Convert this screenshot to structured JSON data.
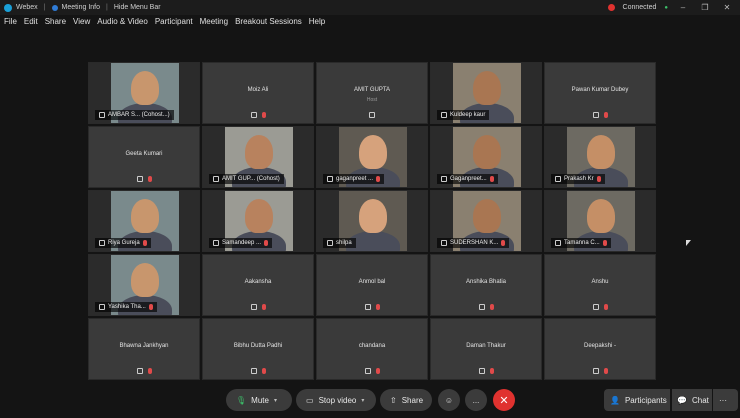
{
  "titlebar": {
    "app": "Webex",
    "meeting_info": "Meeting Info",
    "hide_menu": "Hide Menu Bar",
    "status": "Connected",
    "accent": "#e0322f"
  },
  "menu": [
    "File",
    "Edit",
    "Share",
    "View",
    "Audio & Video",
    "Participant",
    "Meeting",
    "Breakout Sessions",
    "Help"
  ],
  "tiles": [
    {
      "name": "AMBAR S... (Cohost...)",
      "video": true,
      "muted": false
    },
    {
      "name": "Moiz Ali",
      "video": false,
      "muted": true
    },
    {
      "name": "AMIT GUPTA",
      "sub": "Host",
      "video": false,
      "muted": false
    },
    {
      "name": "Kuldeep kaur",
      "video": true,
      "muted": false
    },
    {
      "name": "Pawan Kumar Dubey",
      "video": false,
      "muted": true
    },
    {
      "name": "Geeta Kumari",
      "video": false,
      "muted": true
    },
    {
      "name": "AMIT GUP... (Cohost)",
      "video": true,
      "muted": false
    },
    {
      "name": "gaganpreet ...",
      "video": true,
      "muted": true
    },
    {
      "name": "Gaganpreet...",
      "video": true,
      "muted": true
    },
    {
      "name": "Prakash Kr",
      "video": true,
      "muted": true
    },
    {
      "name": "Riya Gureja",
      "video": true,
      "muted": true
    },
    {
      "name": "Samandeep ...",
      "video": true,
      "muted": true
    },
    {
      "name": "shilpa",
      "video": true,
      "muted": false
    },
    {
      "name": "SUDERSHAN K...",
      "video": true,
      "muted": true
    },
    {
      "name": "Tamanna C...",
      "video": true,
      "muted": true
    },
    {
      "name": "Yashika Tha...",
      "video": true,
      "muted": true
    },
    {
      "name": "Aakansha",
      "video": false,
      "muted": true
    },
    {
      "name": "Anmol bal",
      "video": false,
      "muted": true
    },
    {
      "name": "Anshika Bhatia",
      "video": false,
      "muted": true
    },
    {
      "name": "Anshu",
      "video": false,
      "muted": true
    },
    {
      "name": "Bhawna Jankhyan",
      "video": false,
      "muted": true
    },
    {
      "name": "Bibhu Dutta Padhi",
      "video": false,
      "muted": true
    },
    {
      "name": "chandana",
      "video": false,
      "muted": true
    },
    {
      "name": "Daman Thakur",
      "video": false,
      "muted": true
    },
    {
      "name": "Deepakshi -",
      "video": false,
      "muted": true
    }
  ],
  "controls": {
    "mute": "Mute",
    "stop_video": "Stop video",
    "share": "Share",
    "more": "...",
    "end": "✕",
    "participants": "Participants",
    "chat": "Chat"
  }
}
